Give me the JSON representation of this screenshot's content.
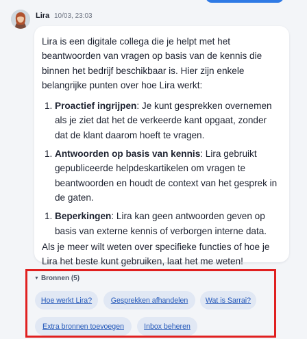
{
  "message": {
    "sender": "Lira",
    "timestamp": "10/03, 23:03",
    "intro": "Lira is een digitale collega die je helpt met het beantwoorden van vragen op basis van de kennis die binnen het bedrijf beschikbaar is. Hier zijn enkele belangrijke punten over hoe Lira werkt:",
    "points": [
      {
        "number": "1.",
        "title": "Proactief ingrijpen",
        "text": ": Je kunt gesprekken overnemen als je ziet dat het de verkeerde kant opgaat, zonder dat de klant daarom hoeft te vragen."
      },
      {
        "number": "1.",
        "title": "Antwoorden op basis van kennis",
        "text": ": Lira gebruikt gepubliceerde helpdeskartikelen om vragen te beantwoorden en houdt de context van het gesprek in de gaten."
      },
      {
        "number": "1.",
        "title": "Beperkingen",
        "text": ": Lira kan geen antwoorden geven op basis van externe kennis of verborgen interne data."
      }
    ],
    "closing": "Als je meer wilt weten over specifieke functies of hoe je Lira het beste kunt gebruiken, laat het me weten!"
  },
  "sources": {
    "toggle_label": "Bronnen (5)",
    "chips": [
      "Hoe werkt Lira?",
      "Gesprekken afhandelen",
      "Wat is Sarrai?",
      "Extra bronnen toevoegen",
      "Inbox beheren"
    ]
  },
  "colors": {
    "chip_bg": "#e1e8f4",
    "chip_text": "#2156b8",
    "highlight_border": "#e02020",
    "send_button": "#2f7ae5"
  },
  "icons": {
    "toggle": "triangle-down-icon"
  }
}
